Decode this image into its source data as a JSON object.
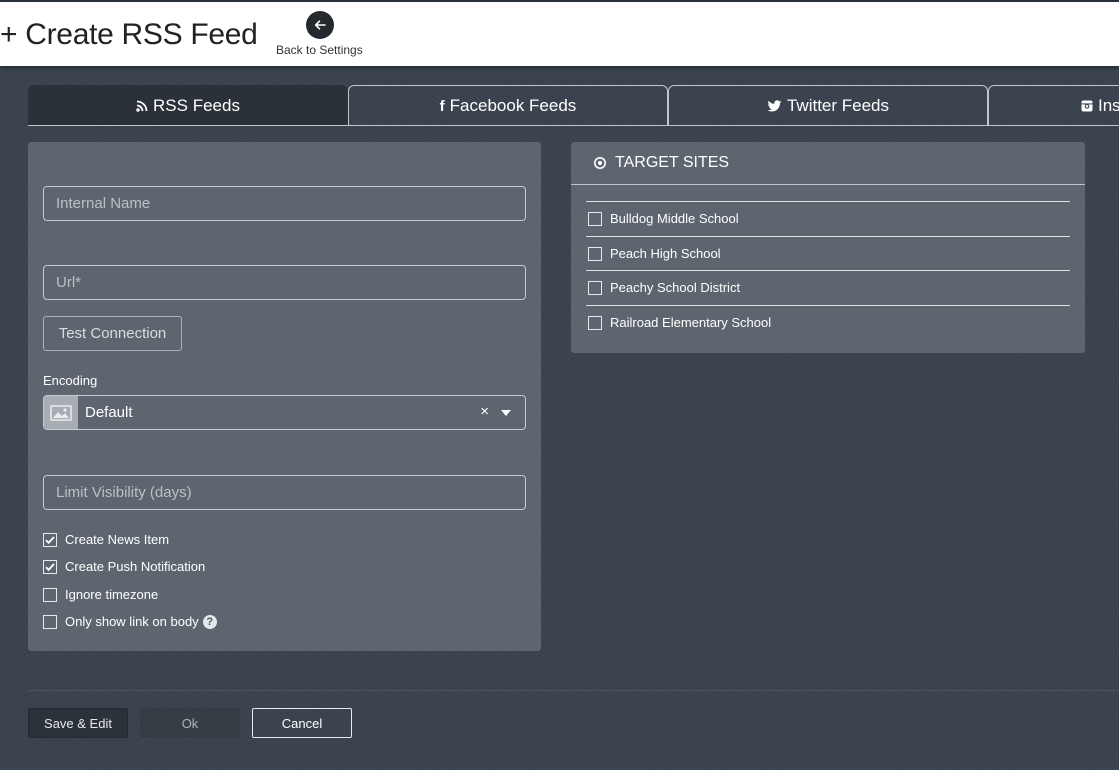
{
  "header": {
    "title": "+ Create RSS Feed",
    "back_label": "Back to Settings"
  },
  "tabs": [
    {
      "label": "RSS Feeds",
      "icon": "rss-icon",
      "active": true
    },
    {
      "label": "Facebook Feeds",
      "icon": "facebook-icon",
      "active": false
    },
    {
      "label": "Twitter Feeds",
      "icon": "twitter-icon",
      "active": false
    },
    {
      "label": "Inst",
      "icon": "instagram-icon",
      "active": false
    }
  ],
  "form": {
    "internal_name_placeholder": "Internal Name",
    "url_placeholder": "Url*",
    "test_connection_label": "Test Connection",
    "encoding_label": "Encoding",
    "encoding_value": "Default",
    "clear_symbol": "×",
    "limit_visibility_placeholder": "Limit Visibility (days)",
    "checkboxes": [
      {
        "label": "Create News Item",
        "checked": true
      },
      {
        "label": "Create Push Notification",
        "checked": true
      },
      {
        "label": "Ignore timezone",
        "checked": false
      },
      {
        "label": "Only show link on body",
        "checked": false
      }
    ],
    "help_symbol": "?"
  },
  "target_sites": {
    "title": "TARGET SITES",
    "sites": [
      {
        "label": "Bulldog Middle School",
        "checked": false
      },
      {
        "label": "Peach High School",
        "checked": false
      },
      {
        "label": "Peachy School District",
        "checked": false
      },
      {
        "label": "Railroad Elementary School",
        "checked": false
      }
    ]
  },
  "footer": {
    "save_edit_label": "Save & Edit",
    "ok_label": "Ok",
    "cancel_label": "Cancel"
  }
}
